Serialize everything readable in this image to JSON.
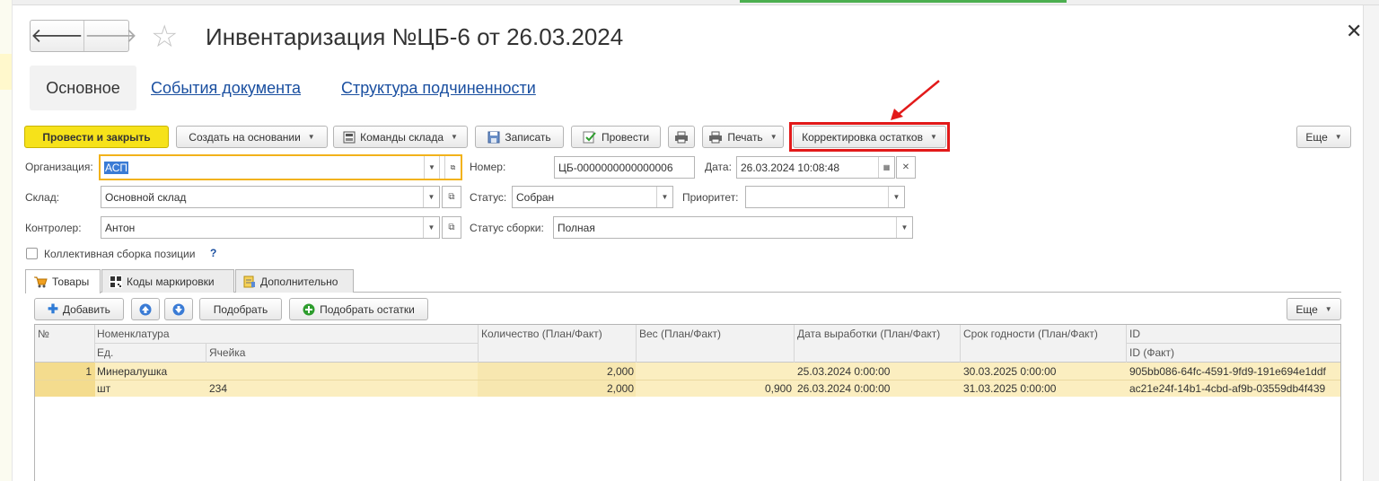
{
  "window": {
    "title": "Инвентаризация №ЦБ-6 от 26.03.2024",
    "back_glyph": "🡐",
    "forward_glyph": "🡒",
    "close_glyph": "✕",
    "star_glyph": "☆"
  },
  "nav_tabs": {
    "main": "Основное",
    "events": "События документа",
    "structure": "Структура подчиненности"
  },
  "toolbar": {
    "post_close": "Провести и закрыть",
    "create_based": "Создать на основании",
    "warehouse_cmds": "Команды склада",
    "save": "Записать",
    "post": "Провести",
    "print": "Печать",
    "correction": "Корректировка остатков",
    "more": "Еще"
  },
  "form": {
    "org_label": "Организация:",
    "org_value": "АСП",
    "number_label": "Номер:",
    "number_value": "ЦБ-0000000000000006",
    "date_label": "Дата:",
    "date_value": "26.03.2024 10:08:48",
    "warehouse_label": "Склад:",
    "warehouse_value": "Основной склад",
    "status_label": "Статус:",
    "status_value": "Собран",
    "priority_label": "Приоритет:",
    "priority_value": "",
    "controller_label": "Контролер:",
    "controller_value": "Антон",
    "assembly_status_label": "Статус сборки:",
    "assembly_status_value": "Полная",
    "collective_label": "Коллективная сборка позиции",
    "help_glyph": "?"
  },
  "panel_tabs": {
    "goods": "Товары",
    "codes": "Коды маркировки",
    "extra": "Дополнительно"
  },
  "grid_toolbar": {
    "add": "Добавить",
    "pick": "Подобрать",
    "pick_stock": "Подобрать остатки",
    "more": "Еще"
  },
  "table": {
    "headers": {
      "num": "№",
      "nomenclature": "Номенклатура",
      "unit": "Ед.",
      "cell": "Ячейка",
      "qty": "Количество (План/Факт)",
      "weight": "Вес (План/Факт)",
      "prod_date": "Дата выработки (План/Факт)",
      "expiry": "Срок годности (План/Факт)",
      "id": "ID",
      "id_fact": "ID (Факт)"
    },
    "rows": [
      {
        "num": "1",
        "nomenclature": "Минералушка",
        "qty": "2,000",
        "weight": "",
        "prod_date": "25.03.2024 0:00:00",
        "expiry": "30.03.2025 0:00:00",
        "id": "905bb086-64fc-4591-9fd9-191e694e1ddf"
      },
      {
        "unit": "шт",
        "cell": "234",
        "qty": "2,000",
        "weight": "0,900",
        "prod_date": "26.03.2024 0:00:00",
        "expiry": "31.03.2025 0:00:00",
        "id": "ac21e24f-14b1-4cbd-af9b-03559db4f439"
      }
    ]
  },
  "colors": {
    "primary_button": "#f6e21a",
    "highlight_box": "#e21a1a",
    "link": "#1a4fa0",
    "row_highlight": "#fbeec0",
    "focus_border": "#f2b21a"
  }
}
